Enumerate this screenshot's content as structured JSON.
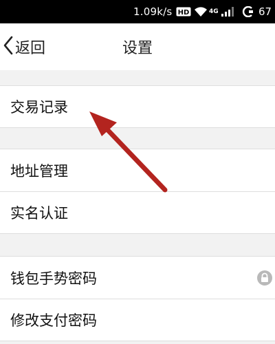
{
  "status_bar": {
    "net_speed": "1.09k/s",
    "network": "4G",
    "battery": "67",
    "icons": [
      "hd-icon",
      "wifi-icon",
      "signal-icon",
      "charging-icon"
    ]
  },
  "header": {
    "back_label": "返回",
    "title": "设置"
  },
  "groups": [
    {
      "rows": [
        {
          "label": "交易记录"
        }
      ]
    },
    {
      "rows": [
        {
          "label": "地址管理"
        },
        {
          "label": "实名认证"
        }
      ]
    },
    {
      "rows": [
        {
          "label": "钱包手势密码",
          "trailing_icon": "lock-icon"
        },
        {
          "label": "修改支付密码"
        }
      ]
    }
  ],
  "colors": {
    "background": "#f2f2f2",
    "surface": "#ffffff",
    "status_bar": "#000000",
    "annotation_arrow": "#b3241f"
  }
}
